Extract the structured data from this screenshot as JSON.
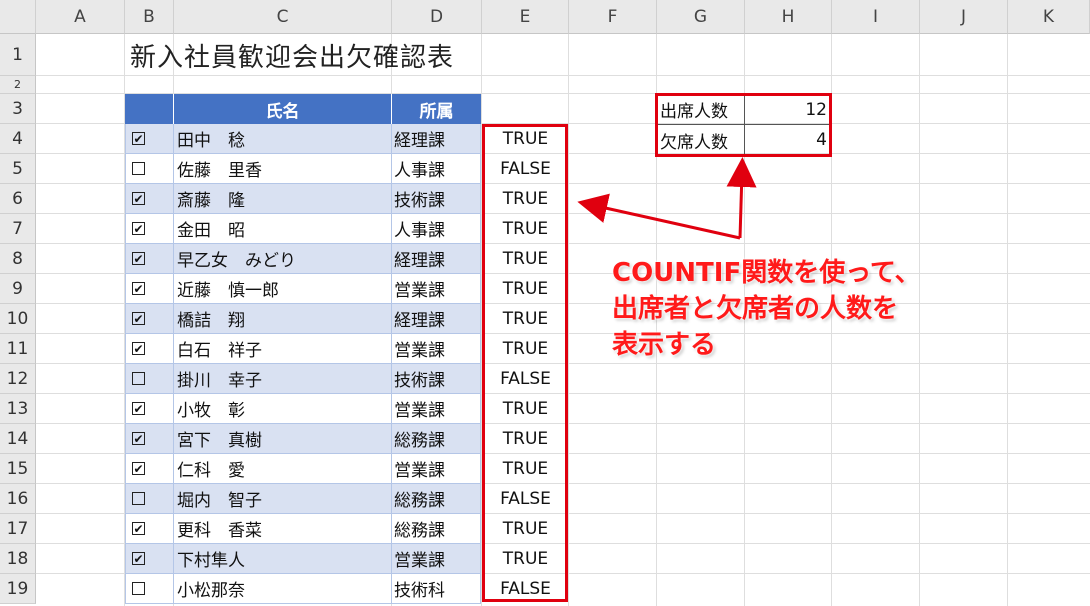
{
  "columns": [
    "A",
    "B",
    "C",
    "D",
    "E",
    "F",
    "G",
    "H",
    "I",
    "J",
    "K"
  ],
  "rows": [
    "1",
    "2",
    "3",
    "4",
    "5",
    "6",
    "7",
    "8",
    "9",
    "10",
    "11",
    "12",
    "13",
    "14",
    "15",
    "16",
    "17",
    "18",
    "19"
  ],
  "title": "新入社員歓迎会出欠確認表",
  "table": {
    "header_name": "氏名",
    "header_dept": "所属",
    "header_color": "#4472c4",
    "band_color": "#d9e1f2",
    "entries": [
      {
        "checked": true,
        "name": "田中　稔",
        "dept": "経理課",
        "value": "TRUE"
      },
      {
        "checked": false,
        "name": "佐藤　里香",
        "dept": "人事課",
        "value": "FALSE"
      },
      {
        "checked": true,
        "name": "斎藤　隆",
        "dept": "技術課",
        "value": "TRUE"
      },
      {
        "checked": true,
        "name": "金田　昭",
        "dept": "人事課",
        "value": "TRUE"
      },
      {
        "checked": true,
        "name": "早乙女　みどり",
        "dept": "経理課",
        "value": "TRUE"
      },
      {
        "checked": true,
        "name": "近藤　慎一郎",
        "dept": "営業課",
        "value": "TRUE"
      },
      {
        "checked": true,
        "name": "橋詰　翔",
        "dept": "経理課",
        "value": "TRUE"
      },
      {
        "checked": true,
        "name": "白石　祥子",
        "dept": "営業課",
        "value": "TRUE"
      },
      {
        "checked": false,
        "name": "掛川　幸子",
        "dept": "技術課",
        "value": "FALSE"
      },
      {
        "checked": true,
        "name": "小牧　彰",
        "dept": "営業課",
        "value": "TRUE"
      },
      {
        "checked": true,
        "name": "宮下　真樹",
        "dept": "総務課",
        "value": "TRUE"
      },
      {
        "checked": true,
        "name": "仁科　愛",
        "dept": "営業課",
        "value": "TRUE"
      },
      {
        "checked": false,
        "name": "堀内　智子",
        "dept": "総務課",
        "value": "FALSE"
      },
      {
        "checked": true,
        "name": "更科　香菜",
        "dept": "総務課",
        "value": "TRUE"
      },
      {
        "checked": true,
        "name": "下村隼人",
        "dept": "営業課",
        "value": "TRUE"
      },
      {
        "checked": false,
        "name": "小松那奈",
        "dept": "技術科",
        "value": "FALSE"
      }
    ]
  },
  "summary": {
    "attend_label": "出席人数",
    "attend_value": "12",
    "absent_label": "欠席人数",
    "absent_value": "4"
  },
  "annotation": {
    "line1": "COUNTIF関数を使って、",
    "line2": "出席者と欠席者の人数を",
    "line3": "表示する",
    "color": "#ff1a1a"
  },
  "check_mark": "✔",
  "highlight_color": "#e0000f"
}
